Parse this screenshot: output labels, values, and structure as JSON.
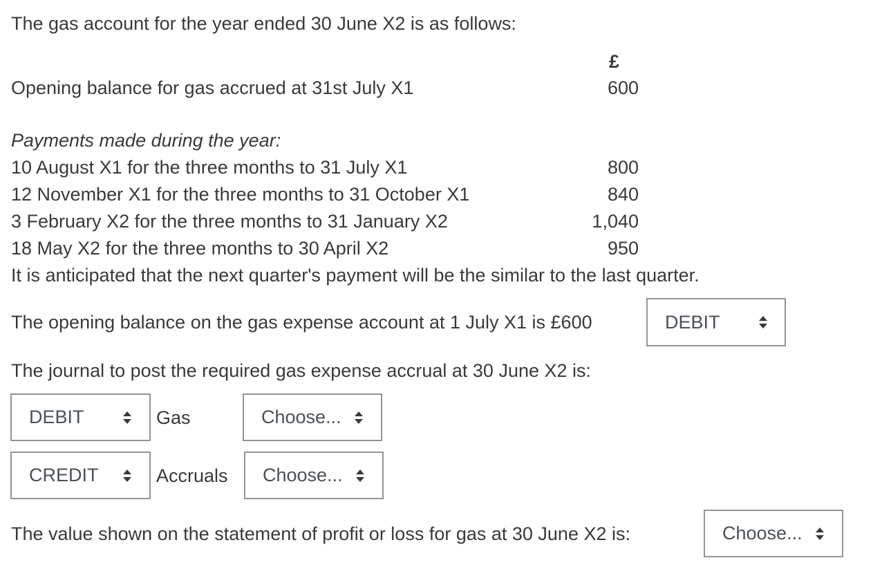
{
  "intro": "The gas account for the year ended 30 June X2 is as follows:",
  "currency_header": "£",
  "opening": {
    "label": "Opening balance for gas accrued at 31st July X1",
    "amount": "600"
  },
  "payments_heading": "Payments made during the year:",
  "payments": [
    {
      "label": "10 August X1 for the three months to 31 July X1",
      "amount": "800"
    },
    {
      "label": "12 November X1 for the three months to 31 October X1",
      "amount": "840"
    },
    {
      "label": "3 February X2 for the three months to 31 January X2",
      "amount": "1,040"
    },
    {
      "label": "18 May X2 for the three months to 30 April X2",
      "amount": "950"
    }
  ],
  "anticipation": "It is anticipated that the next quarter's payment will be the similar to the last quarter.",
  "q1": {
    "text": "The opening balance on the gas expense account at 1 July X1 is £600",
    "select_value": "DEBIT"
  },
  "q2": {
    "text": "The journal to post the required gas expense accrual at 30 June X2 is:",
    "rows": [
      {
        "side": "DEBIT",
        "account": "Gas",
        "amount_select": "Choose..."
      },
      {
        "side": "CREDIT",
        "account": "Accruals",
        "amount_select": "Choose..."
      }
    ]
  },
  "q3": {
    "text": "The value shown on the statement of profit or loss for gas at 30 June X2 is:",
    "select_value": "Choose..."
  }
}
